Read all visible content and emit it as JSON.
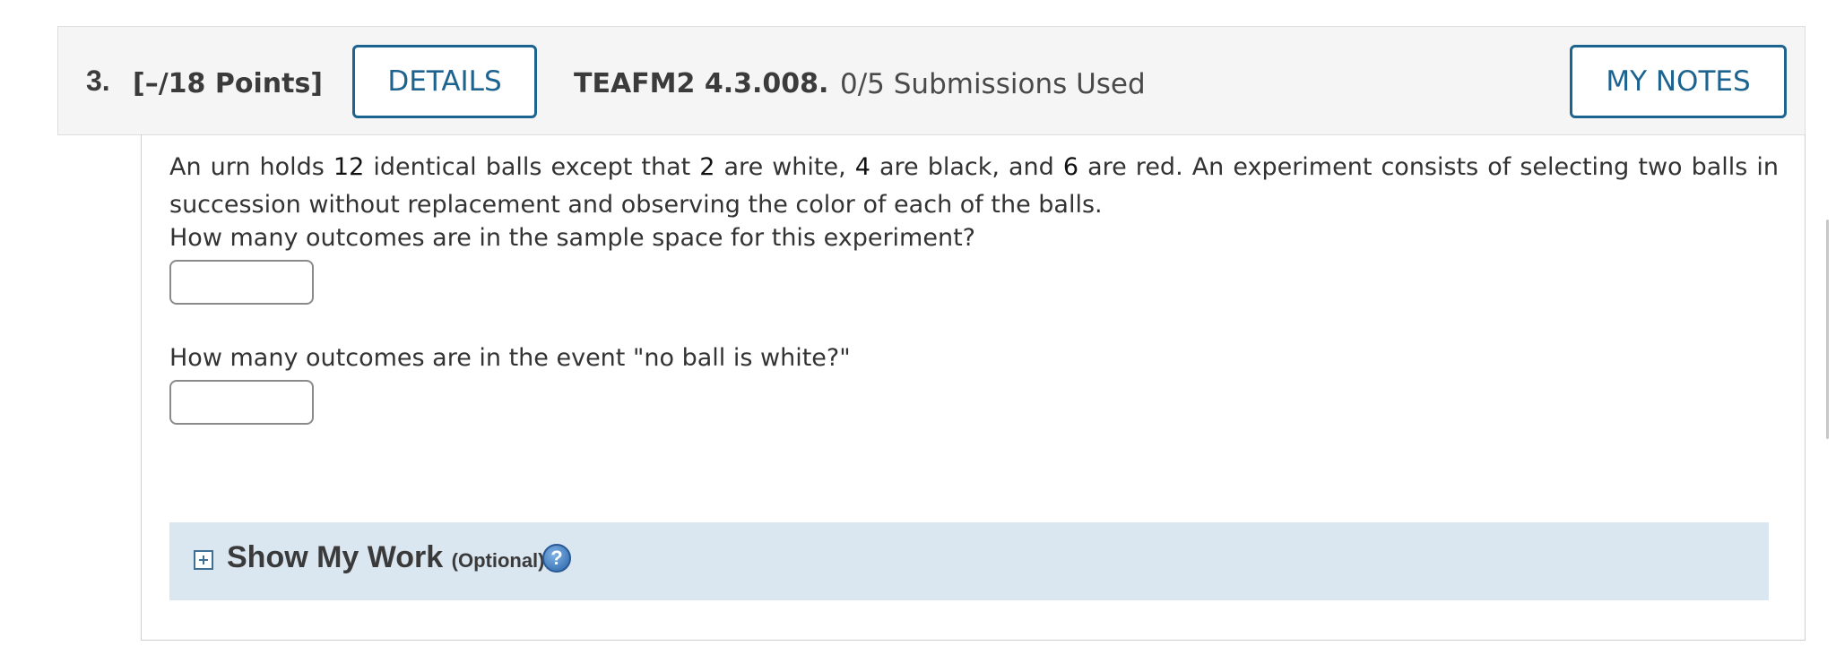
{
  "header": {
    "question_number": "3.",
    "points": "[–/18 Points]",
    "details_label": "DETAILS",
    "problem_code": "TEAFM2 4.3.008.",
    "submissions": "0/5 Submissions Used",
    "my_notes_label": "MY NOTES"
  },
  "problem": {
    "s1": "An urn holds ",
    "n1": "12",
    "s2": " identical balls except that ",
    "n2": "2",
    "s3": " are white, ",
    "n3": "4",
    "s4": " are black, and ",
    "n4": "6",
    "s5": " are red. An experiment consists of selecting two balls in succession without replacement and observing the color of each of the balls.",
    "question1": "How many outcomes are in the sample space for this experiment?",
    "answer1": "",
    "question2": "How many outcomes are in the event \"no ball is white?\"",
    "answer2": ""
  },
  "show_my_work": {
    "title": "Show My Work",
    "optional": "(Optional)",
    "expand_icon": "plus-box-icon",
    "help_icon": "question-mark-icon",
    "help_glyph": "?"
  },
  "colors": {
    "accent": "#1d6390",
    "header_bg": "#f5f5f5",
    "work_bg": "#dae6f0"
  }
}
